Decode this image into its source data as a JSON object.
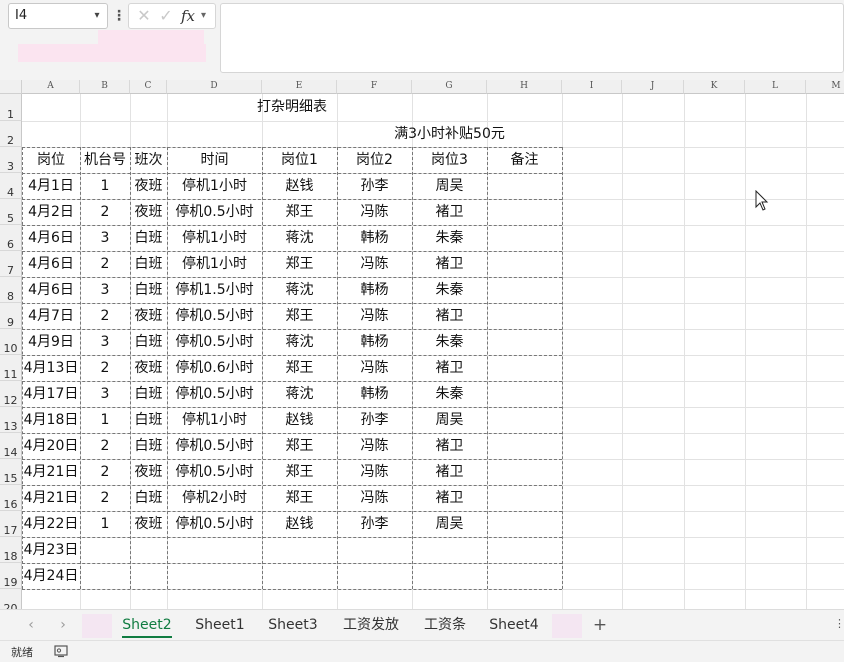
{
  "formula_bar": {
    "name_box": "I4",
    "fx_label": "fx",
    "formula_value": ""
  },
  "colors": {
    "accent": "#107c41",
    "grid_line": "#e2e2e2",
    "header_bg": "#f0f0f0"
  },
  "icons": {
    "cancel": "close-icon",
    "confirm": "check-icon",
    "function": "fx-icon",
    "add_sheet": "plus-icon",
    "accessibility": "accessibility-icon"
  },
  "columns": [
    "A",
    "B",
    "C",
    "D",
    "E",
    "F",
    "G",
    "H",
    "I",
    "J",
    "K",
    "L",
    "M"
  ],
  "rows": [
    "1",
    "2",
    "3",
    "4",
    "5",
    "6",
    "7",
    "8",
    "9",
    "10",
    "11",
    "12",
    "13",
    "14",
    "15",
    "16",
    "17",
    "18",
    "19",
    "20"
  ],
  "sheet": {
    "title": "打杂明细表",
    "subtitle": "满3小时补贴50元",
    "headers": [
      "岗位",
      "机台号",
      "班次",
      "时间",
      "岗位1",
      "岗位2",
      "岗位3",
      "备注"
    ],
    "rows": [
      [
        "4月1日",
        "1",
        "夜班",
        "停机1小时",
        "赵钱",
        "孙李",
        "周吴",
        ""
      ],
      [
        "4月2日",
        "2",
        "夜班",
        "停机0.5小时",
        "郑王",
        "冯陈",
        "褚卫",
        ""
      ],
      [
        "4月6日",
        "3",
        "白班",
        "停机1小时",
        "蒋沈",
        "韩杨",
        "朱秦",
        ""
      ],
      [
        "4月6日",
        "2",
        "白班",
        "停机1小时",
        "郑王",
        "冯陈",
        "褚卫",
        ""
      ],
      [
        "4月6日",
        "3",
        "白班",
        "停机1.5小时",
        "蒋沈",
        "韩杨",
        "朱秦",
        ""
      ],
      [
        "4月7日",
        "2",
        "夜班",
        "停机0.5小时",
        "郑王",
        "冯陈",
        "褚卫",
        ""
      ],
      [
        "4月9日",
        "3",
        "白班",
        "停机0.5小时",
        "蒋沈",
        "韩杨",
        "朱秦",
        ""
      ],
      [
        "4月13日",
        "2",
        "夜班",
        "停机0.6小时",
        "郑王",
        "冯陈",
        "褚卫",
        ""
      ],
      [
        "4月17日",
        "3",
        "白班",
        "停机0.5小时",
        "蒋沈",
        "韩杨",
        "朱秦",
        ""
      ],
      [
        "4月18日",
        "1",
        "白班",
        "停机1小时",
        "赵钱",
        "孙李",
        "周吴",
        ""
      ],
      [
        "4月20日",
        "2",
        "白班",
        "停机0.5小时",
        "郑王",
        "冯陈",
        "褚卫",
        ""
      ],
      [
        "4月21日",
        "2",
        "夜班",
        "停机0.5小时",
        "郑王",
        "冯陈",
        "褚卫",
        ""
      ],
      [
        "4月21日",
        "2",
        "白班",
        "停机2小时",
        "郑王",
        "冯陈",
        "褚卫",
        ""
      ],
      [
        "4月22日",
        "1",
        "夜班",
        "停机0.5小时",
        "赵钱",
        "孙李",
        "周吴",
        ""
      ],
      [
        "4月23日",
        "",
        "",
        "",
        "",
        "",
        "",
        ""
      ],
      [
        "4月24日",
        "",
        "",
        "",
        "",
        "",
        "",
        ""
      ]
    ]
  },
  "tabs": [
    {
      "label": "Sheet2",
      "active": true
    },
    {
      "label": "Sheet1",
      "active": false
    },
    {
      "label": "Sheet3",
      "active": false
    },
    {
      "label": "工资发放",
      "active": false
    },
    {
      "label": "工资条",
      "active": false
    },
    {
      "label": "Sheet4",
      "active": false
    }
  ],
  "tab_nav": {
    "prev": "‹",
    "next": "›",
    "add": "+",
    "more": "⋮"
  },
  "status_bar": {
    "ready": "就绪"
  }
}
